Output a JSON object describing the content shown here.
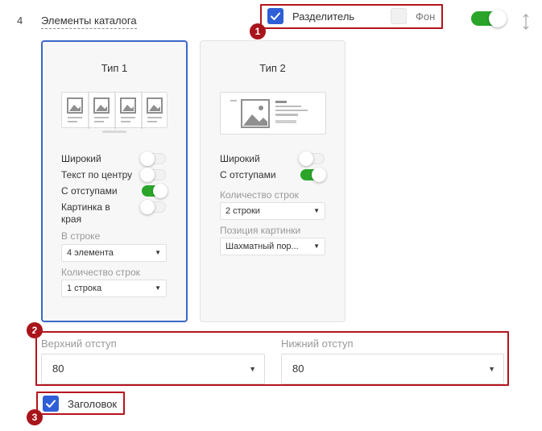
{
  "header": {
    "row_number": "4",
    "section_title": "Элементы каталога",
    "divider_label": "Разделитель",
    "background_label": "Фон"
  },
  "badges": [
    "1",
    "2",
    "3"
  ],
  "type1": {
    "title": "Тип 1",
    "toggles": [
      {
        "label": "Широкий",
        "state": "off"
      },
      {
        "label": "Текст по центру",
        "state": "off"
      },
      {
        "label": "С отступами",
        "state": "on"
      },
      {
        "label": "Картинка в края",
        "state": "off"
      }
    ],
    "per_row_label": "В строке",
    "per_row_value": "4 элемента",
    "rows_label": "Количество строк",
    "rows_value": "1 строка"
  },
  "type2": {
    "title": "Тип 2",
    "toggles": [
      {
        "label": "Широкий",
        "state": "off"
      },
      {
        "label": "С отступами",
        "state": "on"
      }
    ],
    "rows_label": "Количество строк",
    "rows_value": "2 строки",
    "image_pos_label": "Позиция картинки",
    "image_pos_value": "Шахматный пор..."
  },
  "padding": {
    "top_label": "Верхний отступ",
    "top_value": "80",
    "bottom_label": "Нижний отступ",
    "bottom_value": "80"
  },
  "heading_label": "Заголовок",
  "colors": {
    "accent": "#2f5fd6",
    "highlight": "#b4141e",
    "toggle_on": "#2aa52a",
    "selected_border": "#3a67c9"
  }
}
